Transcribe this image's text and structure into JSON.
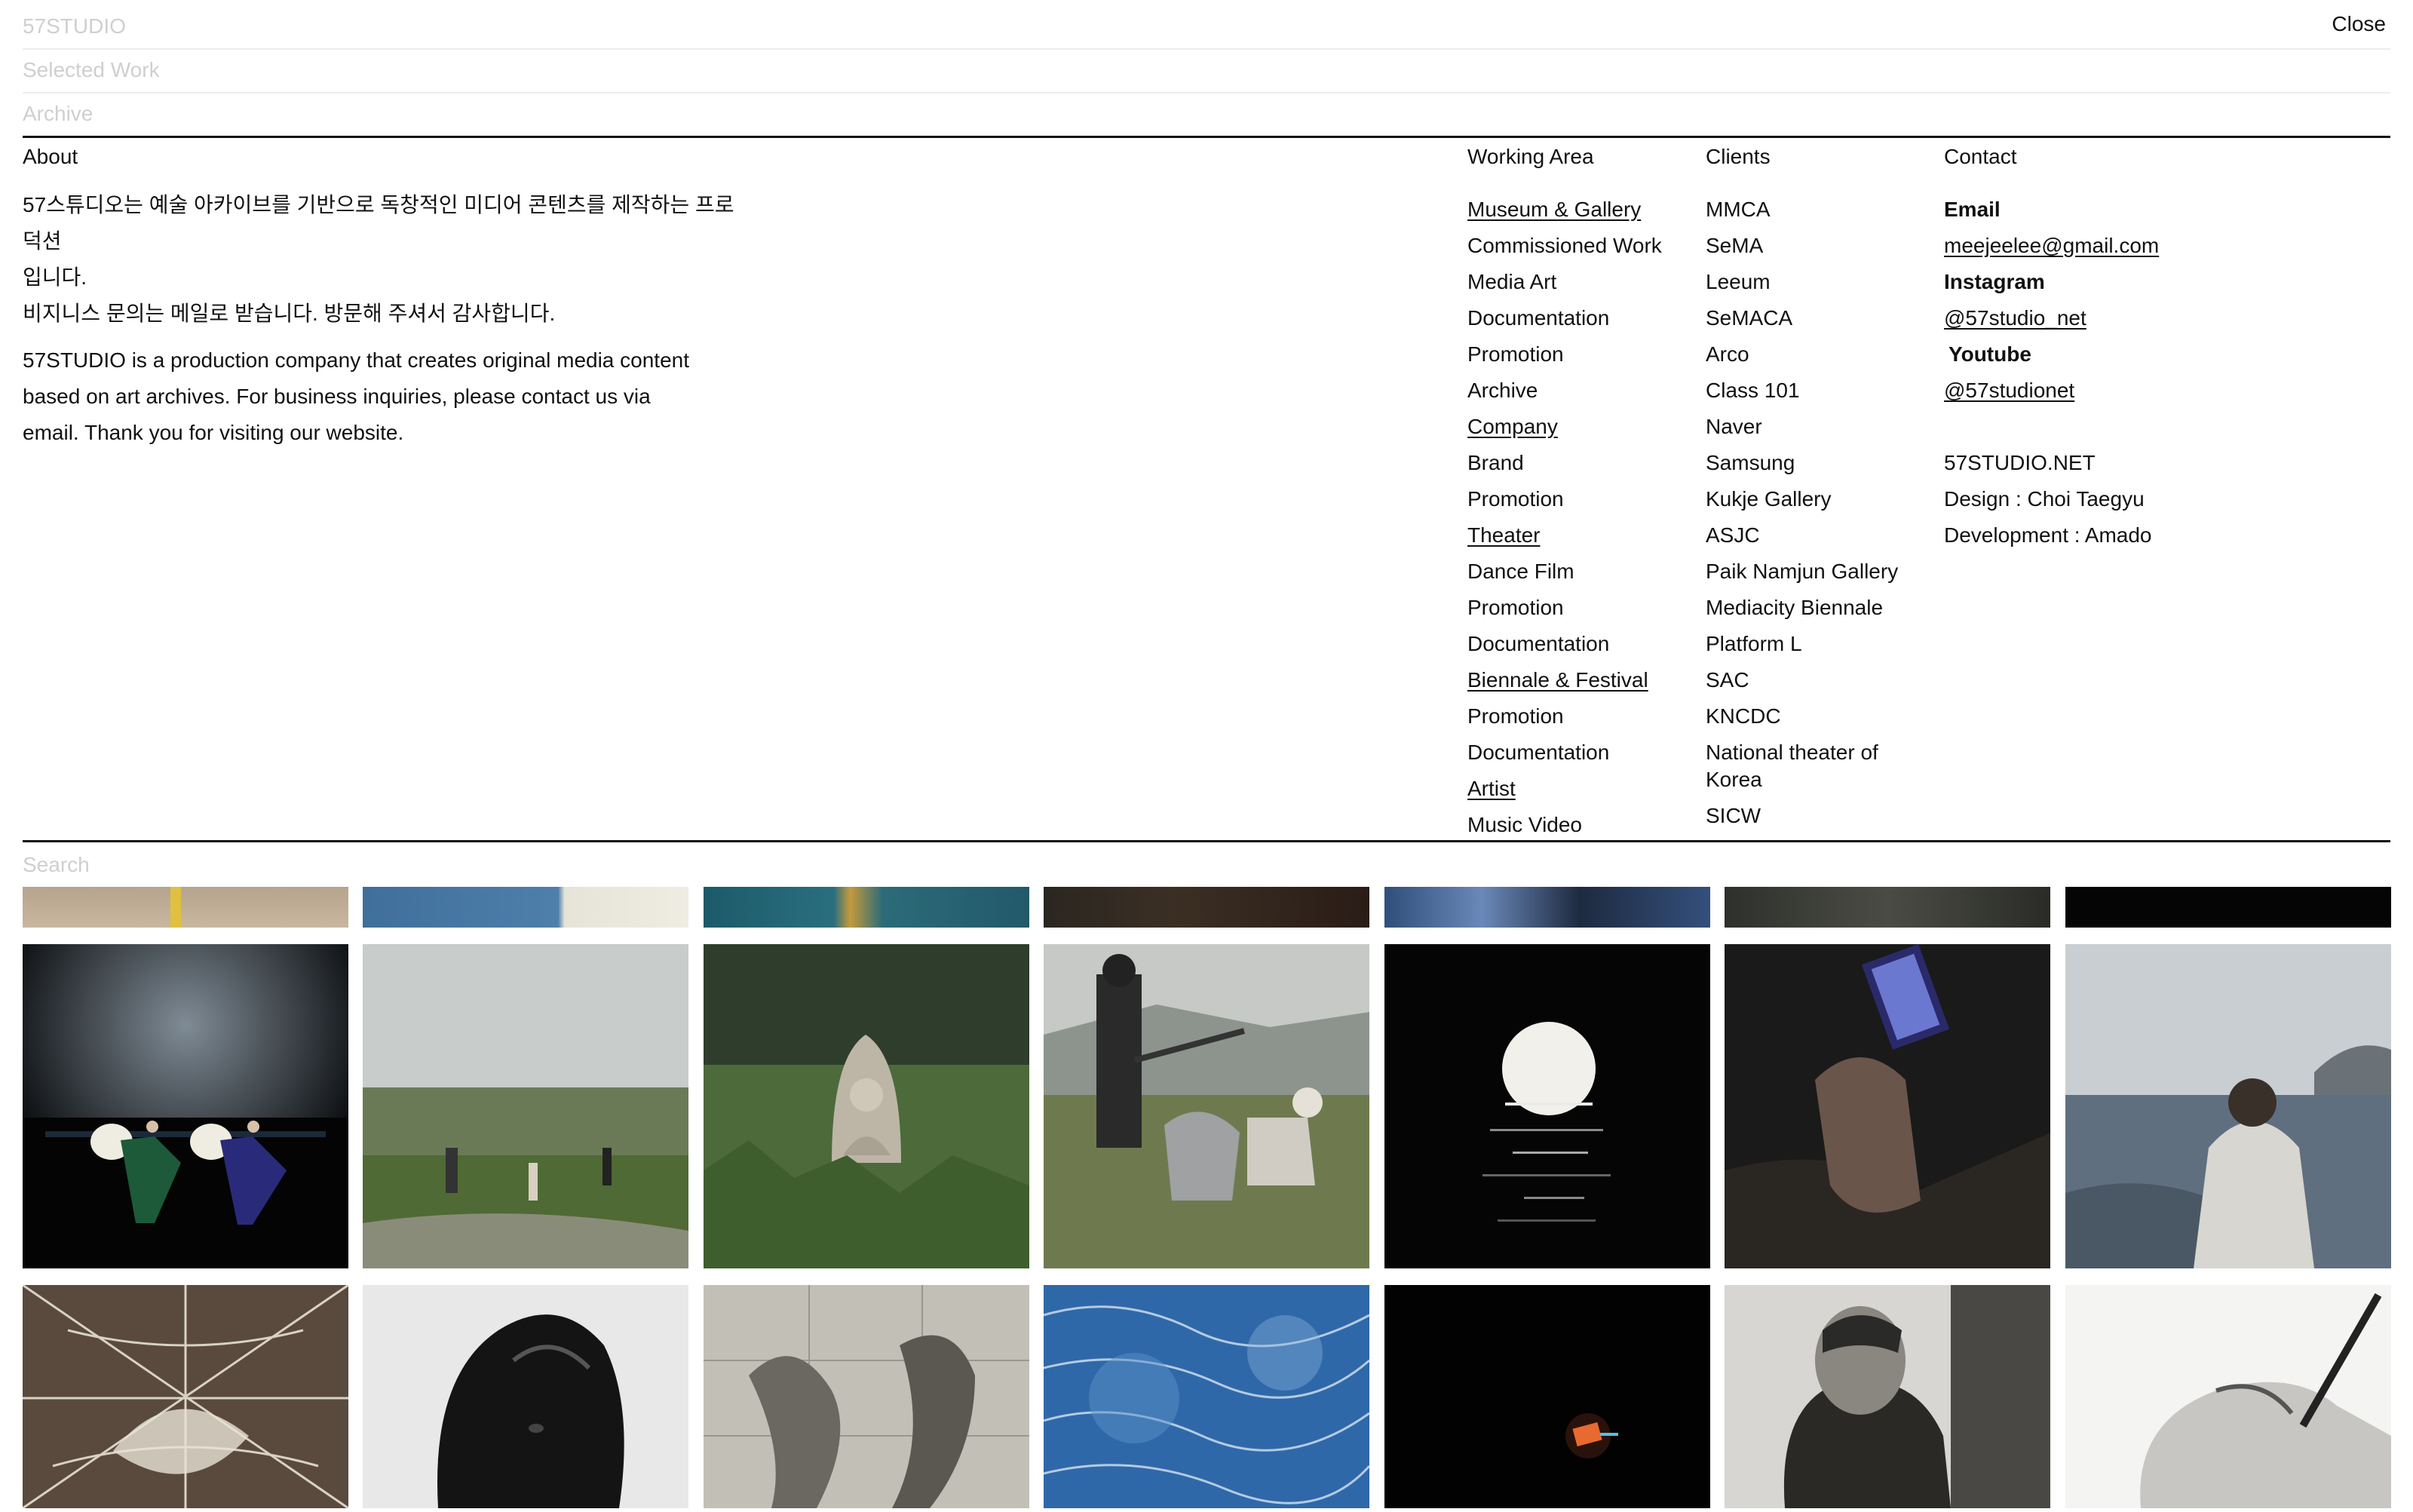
{
  "header": {
    "brand": "57STUDIO",
    "selected_work": "Selected Work",
    "archive": "Archive",
    "close": "Close"
  },
  "about": {
    "title": "About",
    "ko_line1": "57스튜디오는 예술 아카이브를 기반으로 독창적인 미디어 콘텐츠를 제작하는 프로덕션",
    "ko_line2": "입니다.",
    "ko_line3": "비지니스 문의는 메일로 받습니다. 방문해 주셔서 감사합니다.",
    "en_line1": "57STUDIO is a production company that creates original media content",
    "en_line2": "based on art archives. For business inquiries, please contact us via",
    "en_line3": "email. Thank you for visiting our website."
  },
  "working_area": {
    "title": "Working Area",
    "items": [
      {
        "label": "Museum & Gallery",
        "heading": true
      },
      {
        "label": "Commissioned Work",
        "heading": false
      },
      {
        "label": "Media Art",
        "heading": false
      },
      {
        "label": "Documentation",
        "heading": false
      },
      {
        "label": "Promotion",
        "heading": false
      },
      {
        "label": "Archive",
        "heading": false
      },
      {
        "label": "Company",
        "heading": true
      },
      {
        "label": "Brand",
        "heading": false
      },
      {
        "label": "Promotion",
        "heading": false
      },
      {
        "label": "Theater",
        "heading": true
      },
      {
        "label": "Dance Film",
        "heading": false
      },
      {
        "label": "Promotion",
        "heading": false
      },
      {
        "label": "Documentation",
        "heading": false
      },
      {
        "label": "Biennale & Festival",
        "heading": true
      },
      {
        "label": "Promotion",
        "heading": false
      },
      {
        "label": "Documentation",
        "heading": false
      },
      {
        "label": "Artist",
        "heading": true
      },
      {
        "label": "Music Video",
        "heading": false
      }
    ]
  },
  "clients": {
    "title": "Clients",
    "items": [
      "MMCA",
      "SeMA",
      "Leeum",
      "SeMACA",
      "Arco",
      "Class 101",
      "Naver",
      "Samsung",
      "Kukje Gallery",
      "ASJC",
      "Paik Namjun Gallery",
      "Mediacity Biennale",
      "Platform L",
      "SAC",
      "KNCDC",
      "National theater of Korea",
      "SICW"
    ]
  },
  "contact": {
    "title": "Contact",
    "email_label": "Email",
    "email": "meejeelee@gmail.com",
    "instagram_label": "Instagram",
    "instagram": "@57studio_net",
    "youtube_label": "Youtube",
    "youtube": "@57studionet",
    "site": "57STUDIO.NET",
    "design": "Design : Choi Taegyu",
    "development": "Development : Amado"
  },
  "search": {
    "placeholder": "Search"
  },
  "gallery": {
    "strip": [
      {
        "name": "thumb-road-top",
        "bg": "linear-gradient(180deg,#b5a48e,#c9b79f)",
        "accent": "#e0c040"
      },
      {
        "name": "thumb-blue-wall-top",
        "bg": "linear-gradient(90deg,#3f6f9a 0%,#4e7faa 60%,#e6e4d8 62%,#efece2 100%)"
      },
      {
        "name": "thumb-teal-top",
        "bg": "linear-gradient(90deg,#1c5a6a 0%,#2a6f7e 40%,#c49a3c 45%,#2b6b78 55%,#23596a 100%)"
      },
      {
        "name": "thumb-dark-interior-top",
        "bg": "linear-gradient(90deg,#2a2620,#3b2f24 40%,#2a1c16 100%)"
      },
      {
        "name": "thumb-blue-figure-top",
        "bg": "linear-gradient(90deg,#2f4f7a,#6a88b8 30%,#1e2a40 60%,#34507c 100%)"
      },
      {
        "name": "thumb-frame-top",
        "bg": "linear-gradient(90deg,#2e302c,#4a4c44 50%,#2a2b27 100%)"
      },
      {
        "name": "thumb-black-top",
        "bg": "#050505"
      }
    ],
    "row1": [
      {
        "name": "thumb-stage-performance",
        "kind": "stage"
      },
      {
        "name": "thumb-field-filming",
        "kind": "field"
      },
      {
        "name": "thumb-stone-buddha",
        "kind": "buddha"
      },
      {
        "name": "thumb-film-crew",
        "kind": "crew"
      },
      {
        "name": "thumb-moon-water",
        "kind": "moon"
      },
      {
        "name": "thumb-phone-hand",
        "kind": "phone"
      },
      {
        "name": "thumb-man-sea",
        "kind": "sea"
      }
    ],
    "row2": [
      {
        "name": "thumb-butterfly-web",
        "kind": "web"
      },
      {
        "name": "thumb-black-sculpture",
        "kind": "sculpture"
      },
      {
        "name": "thumb-figure-drawing",
        "kind": "drawing"
      },
      {
        "name": "thumb-blue-texture",
        "kind": "bluetex"
      },
      {
        "name": "thumb-glowing-object",
        "kind": "glow"
      },
      {
        "name": "thumb-artist-portrait",
        "kind": "portrait"
      },
      {
        "name": "thumb-hand-pen",
        "kind": "handpen"
      }
    ]
  }
}
